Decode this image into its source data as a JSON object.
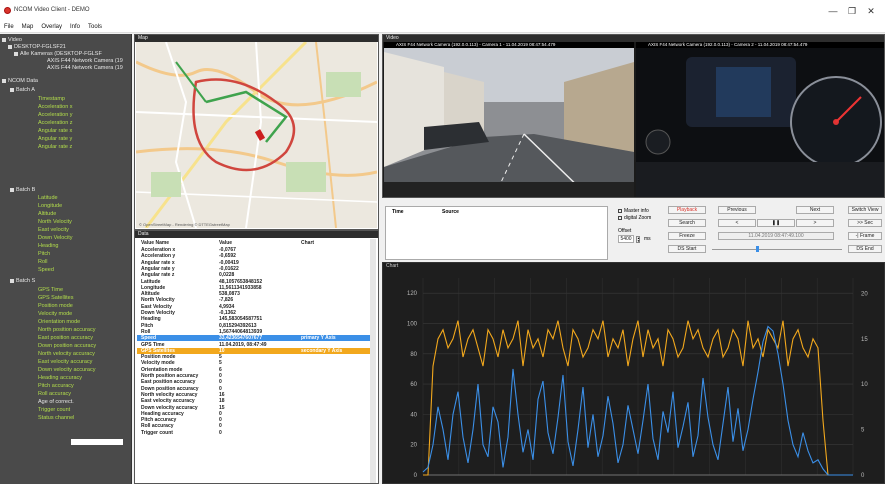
{
  "window": {
    "title": "NCOM Video Client - DEMO",
    "minimize_glyph": "—",
    "maximize_glyph": "❐",
    "close_glyph": "✕"
  },
  "menu": [
    "File",
    "Map",
    "Overlay",
    "Info",
    "Tools"
  ],
  "tree": {
    "video_root": "Video",
    "desktop_node": "DESKTOP-FGLSF21",
    "cameras_node": "Alle Kameras (DESKTOP-FGLSF",
    "cam1": "AXIS F44 Network Camera (19",
    "cam2": "AXIS F44 Network Camera (19",
    "ncom_root": "NCOM Data",
    "batch_a": "Batch A",
    "batch_a_items": [
      "Timestamp",
      "Acceleration x",
      "Acceleration y",
      "Acceleration z",
      "Angular rate x",
      "Angular rate y",
      "Angular rate z"
    ],
    "batch_b": "Batch B",
    "batch_b_items": [
      "Latitude",
      "Longitude",
      "Altitude",
      "North Velocity",
      "East velocity",
      "Down Velocity",
      "Heading",
      "Pitch",
      "Roll",
      "Speed"
    ],
    "batch_s": "Batch S",
    "batch_s_items": [
      "GPS Time",
      "GPS Satellites",
      "Position mode",
      "Velocity mode",
      "Orientation mode",
      "North position accuracy",
      "East position accuracy",
      "Down position accuracy",
      "North velocity accuracy",
      "East velocity accuracy",
      "Down velocity accuracy",
      "Heading accuracy",
      "Pitch accuracy",
      "Roll accuracy",
      "Age of correct.",
      "Trigger count",
      "Status channel"
    ]
  },
  "map": {
    "header": "Map",
    "attribution": "© OpenStreetMap - Rendering © DTTEGstreetMap"
  },
  "data": {
    "header": "Data",
    "columns": [
      "Value Name",
      "Value",
      "Chart"
    ],
    "rows": [
      [
        "Acceleration x",
        "-0,0767",
        ""
      ],
      [
        "Acceleration y",
        "-0,6592",
        ""
      ],
      [
        "Angular rate x",
        "-0,00419",
        ""
      ],
      [
        "Angular rate y",
        "-0,01622",
        ""
      ],
      [
        "Angular rate z",
        "0,0228",
        ""
      ],
      [
        "Latitude",
        "48,1057653848152",
        ""
      ],
      [
        "Longitude",
        "11,5611341933858",
        ""
      ],
      [
        "Altitude",
        "538,0873",
        ""
      ],
      [
        "North Velocity",
        "-7,826",
        ""
      ],
      [
        "East Velocity",
        "4,9934",
        ""
      ],
      [
        "Down Velocity",
        "-0,1362",
        ""
      ],
      [
        "Heading",
        "145,583054587751",
        ""
      ],
      [
        "Pitch",
        "0,815294392613",
        ""
      ],
      [
        "Roll",
        "1,56744064813939",
        ""
      ],
      [
        "Speed",
        "33,4236547607677",
        "primary Y Axis"
      ],
      [
        "GPS Time",
        "11.04.2019, 08:47:49",
        ""
      ],
      [
        "GPS Satellites",
        "10",
        "secondary Y Axis"
      ],
      [
        "Position mode",
        "5",
        ""
      ],
      [
        "Velocity mode",
        "5",
        ""
      ],
      [
        "Orientation mode",
        "6",
        ""
      ],
      [
        "North position accuracy",
        "0",
        ""
      ],
      [
        "East position accuracy",
        "0",
        ""
      ],
      [
        "Down position accuracy",
        "0",
        ""
      ],
      [
        "North velocity accuracy",
        "16",
        ""
      ],
      [
        "East velocity accuracy",
        "18",
        ""
      ],
      [
        "Down velocity accuracy",
        "15",
        ""
      ],
      [
        "Heading accuracy",
        "0",
        ""
      ],
      [
        "Pitch accuracy",
        "0",
        ""
      ],
      [
        "Roll accuracy",
        "0",
        ""
      ],
      [
        "Trigger count",
        "0",
        ""
      ]
    ]
  },
  "video": {
    "header": "Video",
    "cam1_caption": "AXIS F44 Network Camera (192.0.0.113) - Camera 1 - 11.04.2019 08:47:54.479",
    "cam2_caption": "AXIS F44 Network Camera (192.0.0.113) - Camera 2 - 11.04.2019 08:47:54.479"
  },
  "controls": {
    "time_col": "Time",
    "source_col": "Source",
    "master_info": "Master info",
    "digital_zoom": "digital Zoom",
    "offset_label": "Offset",
    "offset_value": "5400",
    "offset_unit": "ms",
    "btn_playback": "Playback",
    "btn_search": "Search",
    "btn_freeze": "Freeze",
    "btn_ds_start": "DS Start",
    "btn_previous": "Previous",
    "btn_next": "Next",
    "btn_prev_arrow": "<",
    "btn_pause": "❚❚",
    "btn_next_arrow": ">",
    "timestamp": "11.04.2019 08:47:49.100",
    "btn_switch_view": "Switch View",
    "btn_sec": ">> Sec",
    "btn_frame": "-| Frame",
    "btn_ds_end": "DS End"
  },
  "chart_header": "Chart",
  "chart_data": {
    "type": "line",
    "title": "",
    "y_left_ticks": [
      0,
      20,
      40,
      60,
      80,
      100,
      120
    ],
    "y_right_ticks": [
      0,
      5,
      10,
      15,
      20
    ],
    "ylim_left": [
      0,
      130
    ],
    "ylim_right": [
      0,
      21.7
    ],
    "grid": true,
    "series": [
      {
        "color": "#f2a81d",
        "axis": "secondary",
        "values": [
          0,
          0,
          12,
          15,
          16,
          14,
          15,
          17,
          13,
          15,
          16,
          14,
          12,
          16,
          15,
          13,
          16,
          14,
          15,
          17,
          12,
          16,
          14,
          15,
          13,
          16,
          15,
          17,
          14,
          12,
          16,
          15,
          13,
          14,
          16,
          15,
          17,
          13,
          15,
          14,
          16,
          12,
          15,
          17,
          13,
          16,
          14,
          15,
          12,
          16,
          15,
          13,
          14,
          17,
          15,
          16,
          14,
          13,
          15,
          16,
          13,
          14,
          16,
          15,
          12,
          17,
          14,
          15,
          13,
          16,
          15,
          14,
          17,
          12,
          15,
          16,
          14,
          13,
          15,
          14,
          6,
          0,
          0,
          0,
          0,
          0,
          0
        ]
      },
      {
        "color": "#3b8fe7",
        "axis": "primary",
        "values": [
          2,
          5,
          20,
          45,
          30,
          10,
          40,
          55,
          25,
          8,
          30,
          60,
          20,
          12,
          45,
          35,
          5,
          25,
          70,
          40,
          15,
          30,
          10,
          50,
          62,
          28,
          14,
          38,
          66,
          22,
          6,
          30,
          58,
          18,
          40,
          12,
          26,
          52,
          34,
          8,
          20,
          46,
          30,
          14,
          36,
          60,
          24,
          10,
          42,
          28,
          55,
          18,
          32,
          48,
          12,
          26,
          64,
          38,
          20,
          10,
          34,
          58,
          22,
          44,
          16,
          30,
          50,
          68,
          88,
          98,
          95,
          80,
          60,
          36,
          20,
          12,
          28,
          16,
          8,
          10,
          4,
          0,
          0,
          0,
          0,
          0,
          0
        ]
      }
    ]
  },
  "colors": {
    "tree_bg": "#4a4a4a",
    "tree_green": "#b3de4c",
    "speed_blue": "#3b8fe7",
    "sats_orange": "#f2a81d",
    "chart_bg": "#1e1e1e"
  }
}
